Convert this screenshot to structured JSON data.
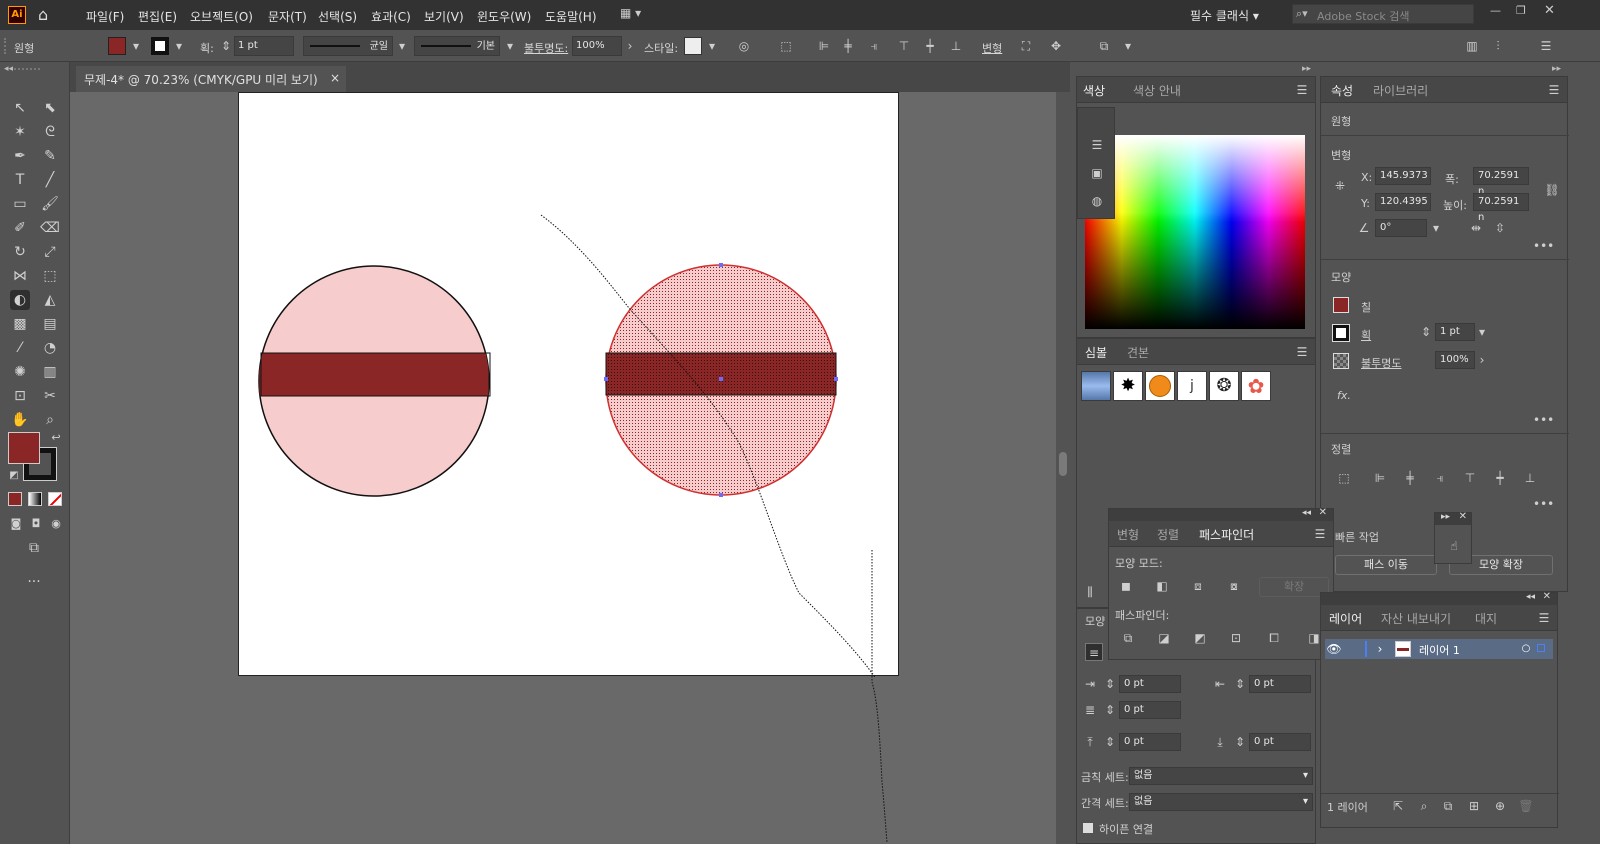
{
  "app": {
    "logo": "Ai",
    "menus": [
      "파일(F)",
      "편집(E)",
      "오브젝트(O)",
      "문자(T)",
      "선택(S)",
      "효과(C)",
      "보기(V)",
      "윈도우(W)",
      "도움말(H)"
    ],
    "workspace": "필수 클래식",
    "search_placeholder": "Adobe Stock 검색"
  },
  "control_bar": {
    "object_type": "원형",
    "stroke_label": "획:",
    "stroke_weight": "1 pt",
    "stroke_profile": "균일",
    "brush": "기본",
    "opacity_label": "불투명도:",
    "opacity": "100%",
    "style_label": "스타일:",
    "transform_label": "변형",
    "fill_color": "#8b2626"
  },
  "document": {
    "tab_title": "무제-4* @ 70.23% (CMYK/GPU 미리 보기)",
    "close": "×"
  },
  "color_panel": {
    "tabs": [
      "색상",
      "색상 안내"
    ]
  },
  "symbols_panel": {
    "tabs": [
      "심볼",
      "견본"
    ],
    "symbols": [
      "blue-banner",
      "ink-splat",
      "orange-button",
      "grunge",
      "floral-ring",
      "flower"
    ]
  },
  "pathfinder_panel": {
    "tabs": [
      "변형",
      "정렬",
      "패스파인더"
    ],
    "shape_modes_label": "모양 모드:",
    "expand_label": "확장",
    "pathfinders_label": "패스파인더:"
  },
  "paragraph_panel": {
    "left_label": "모양",
    "indent_left": "0 pt",
    "indent_right": "0 pt",
    "first_line": "0 pt",
    "space_before": "0 pt",
    "space_after": "0 pt",
    "kinsoku_label": "금칙 세트:",
    "kinsoku_value": "없음",
    "mojikumi_label": "간격 세트:",
    "mojikumi_value": "없음",
    "hyphen_label": "하이픈 연결"
  },
  "properties_panel": {
    "tabs": [
      "속성",
      "라이브러리"
    ],
    "object_type": "원형",
    "transform_title": "변형",
    "x_label": "X:",
    "x": "145.9373",
    "y_label": "Y:",
    "y": "120.4395",
    "w_label": "폭:",
    "w": "70.2591 n",
    "h_label": "높이:",
    "h": "70.2591 n",
    "angle": "0°",
    "appearance_title": "모양",
    "fill_label": "칠",
    "stroke_label": "획",
    "stroke_weight": "1 pt",
    "opacity_label": "불투명도",
    "opacity": "100%",
    "fx": "fx.",
    "align_title": "정렬",
    "quick_actions_title": "빠른 작업",
    "offset_path": "패스 이동",
    "expand_shape": "모양 확장",
    "fill_color": "#8b2626"
  },
  "layers_panel": {
    "tabs": [
      "레이어",
      "자산 내보내기",
      "대지"
    ],
    "layer_name": "레이어 1",
    "count": "1 레이어"
  },
  "tool_panel": {
    "fill_color": "#8b2626",
    "more": "..."
  }
}
